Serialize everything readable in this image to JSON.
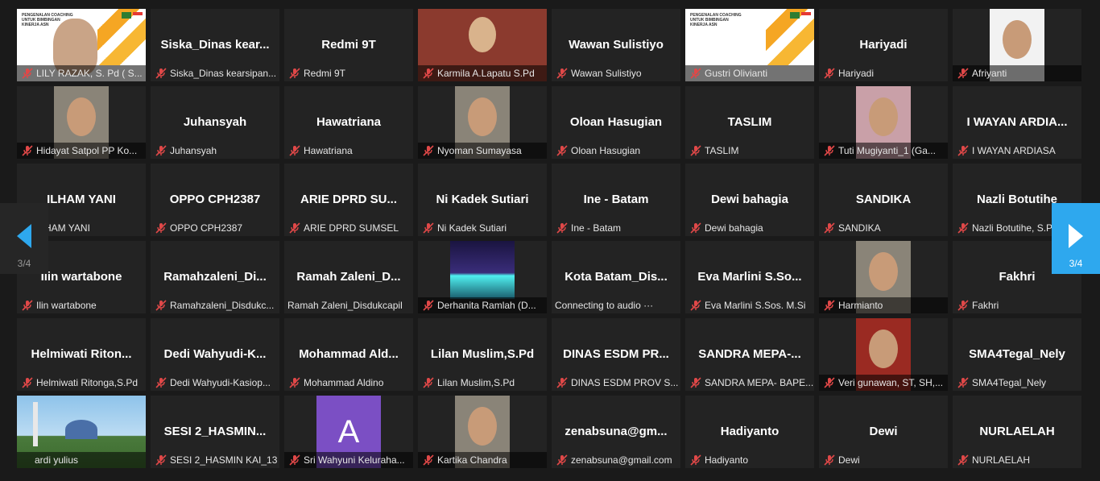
{
  "pagination": {
    "current": "3/4"
  },
  "colors": {
    "muted_mic": "#e04848",
    "nav_right": "#2ea8ee"
  },
  "tiles": [
    {
      "display": "",
      "name": "LILY RAZAK, S. Pd ( S...",
      "media": "slide"
    },
    {
      "display": "Siska_Dinas kear...",
      "name": "Siska_Dinas kearsipan...",
      "media": ""
    },
    {
      "display": "Redmi 9T",
      "name": "Redmi 9T",
      "media": ""
    },
    {
      "display": "",
      "name": "Karmila A.Lapatu S.Pd",
      "media": "room"
    },
    {
      "display": "Wawan Sulistiyo",
      "name": "Wawan Sulistiyo",
      "media": ""
    },
    {
      "display": "",
      "name": "Gustri Olivianti",
      "media": "slide-empty"
    },
    {
      "display": "Hariyadi",
      "name": "Hariyadi",
      "media": ""
    },
    {
      "display": "",
      "name": "Afriyanti",
      "media": "video-light"
    },
    {
      "display": "",
      "name": "Hidayat Satpol PP Ko...",
      "media": "video"
    },
    {
      "display": "Juhansyah",
      "name": "Juhansyah",
      "media": ""
    },
    {
      "display": "Hawatriana",
      "name": "Hawatriana",
      "media": ""
    },
    {
      "display": "",
      "name": "Nyoman Sumayasa",
      "media": "video"
    },
    {
      "display": "Oloan Hasugian",
      "name": "Oloan Hasugian",
      "media": ""
    },
    {
      "display": "TASLIM",
      "name": "TASLIM",
      "media": ""
    },
    {
      "display": "",
      "name": "Tuti Mugiyanti_1 (Ga...",
      "media": "video-pink"
    },
    {
      "display": "I WAYAN ARDIA...",
      "name": "I WAYAN ARDIASA",
      "media": ""
    },
    {
      "display": "ILHAM YANI",
      "name": "ILHAM YANI",
      "media": ""
    },
    {
      "display": "OPPO CPH2387",
      "name": "OPPO CPH2387",
      "media": ""
    },
    {
      "display": "ARIE DPRD SU...",
      "name": "ARIE DPRD SUMSEL",
      "media": ""
    },
    {
      "display": "Ni Kadek Sutiari",
      "name": "Ni Kadek Sutiari",
      "media": ""
    },
    {
      "display": "Ine - Batam",
      "name": "Ine - Batam",
      "media": ""
    },
    {
      "display": "Dewi bahagia",
      "name": "Dewi bahagia",
      "media": ""
    },
    {
      "display": "SANDIKA",
      "name": "SANDIKA",
      "media": ""
    },
    {
      "display": "Nazli  Botutihe",
      "name": "Nazli Botutihe, S.Pd",
      "media": ""
    },
    {
      "display": "Ilin wartabone",
      "name": "Ilin wartabone",
      "media": ""
    },
    {
      "display": "Ramahzaleni_Di...",
      "name": "Ramahzaleni_Disdukc...",
      "media": ""
    },
    {
      "display": "Ramah  Zaleni_D...",
      "name": "Ramah Zaleni_Disdukcapil",
      "media": "",
      "nomic": true
    },
    {
      "display": "",
      "name": "Derhanita Ramlah (D...",
      "media": "night"
    },
    {
      "display": "Kota  Batam_Dis...",
      "name": "Connecting to audio ···",
      "media": "",
      "nomic": true
    },
    {
      "display": "Eva  Marlini  S.So...",
      "name": "Eva Marlini S.Sos. M.Si",
      "media": ""
    },
    {
      "display": "",
      "name": "Harmianto",
      "media": "video"
    },
    {
      "display": "Fakhri",
      "name": "Fakhri",
      "media": ""
    },
    {
      "display": "Helmiwati  Riton...",
      "name": "Helmiwati Ritonga,S.Pd",
      "media": ""
    },
    {
      "display": "Dedi  Wahyudi-K...",
      "name": "Dedi Wahyudi-Kasiop...",
      "media": ""
    },
    {
      "display": "Mohammad  Ald...",
      "name": "Mohammad Aldino",
      "media": ""
    },
    {
      "display": "Lilan Muslim,S.Pd",
      "name": "Lilan Muslim,S.Pd",
      "media": ""
    },
    {
      "display": "DINAS  ESDM  PR...",
      "name": "DINAS ESDM PROV S...",
      "media": ""
    },
    {
      "display": "SANDRA  MEPA-...",
      "name": "SANDRA MEPA- BAPE...",
      "media": ""
    },
    {
      "display": "",
      "name": "Veri gunawan, ST, SH,...",
      "media": "video-red"
    },
    {
      "display": "SMA4Tegal_Nely",
      "name": "SMA4Tegal_Nely",
      "media": ""
    },
    {
      "display": "",
      "name": "ardi yulius",
      "media": "mosque",
      "nomic": true
    },
    {
      "display": "SESI  2_HASMIN...",
      "name": "SESI 2_HASMIN KAI_13",
      "media": ""
    },
    {
      "display": "",
      "name": "Sri Wahyuni Keluraha...",
      "media": "avatar",
      "avatar_letter": "A"
    },
    {
      "display": "",
      "name": "Kartika Chandra",
      "media": "video"
    },
    {
      "display": "zenabsuna@gm...",
      "name": "zenabsuna@gmail.com",
      "media": ""
    },
    {
      "display": "Hadiyanto",
      "name": "Hadiyanto",
      "media": ""
    },
    {
      "display": "Dewi",
      "name": "Dewi",
      "media": ""
    },
    {
      "display": "NURLAELAH",
      "name": "NURLAELAH",
      "media": ""
    }
  ],
  "slide_title": "PENGENALAN COACHING UNTUK BIMBINGAN KINERJA ASN"
}
